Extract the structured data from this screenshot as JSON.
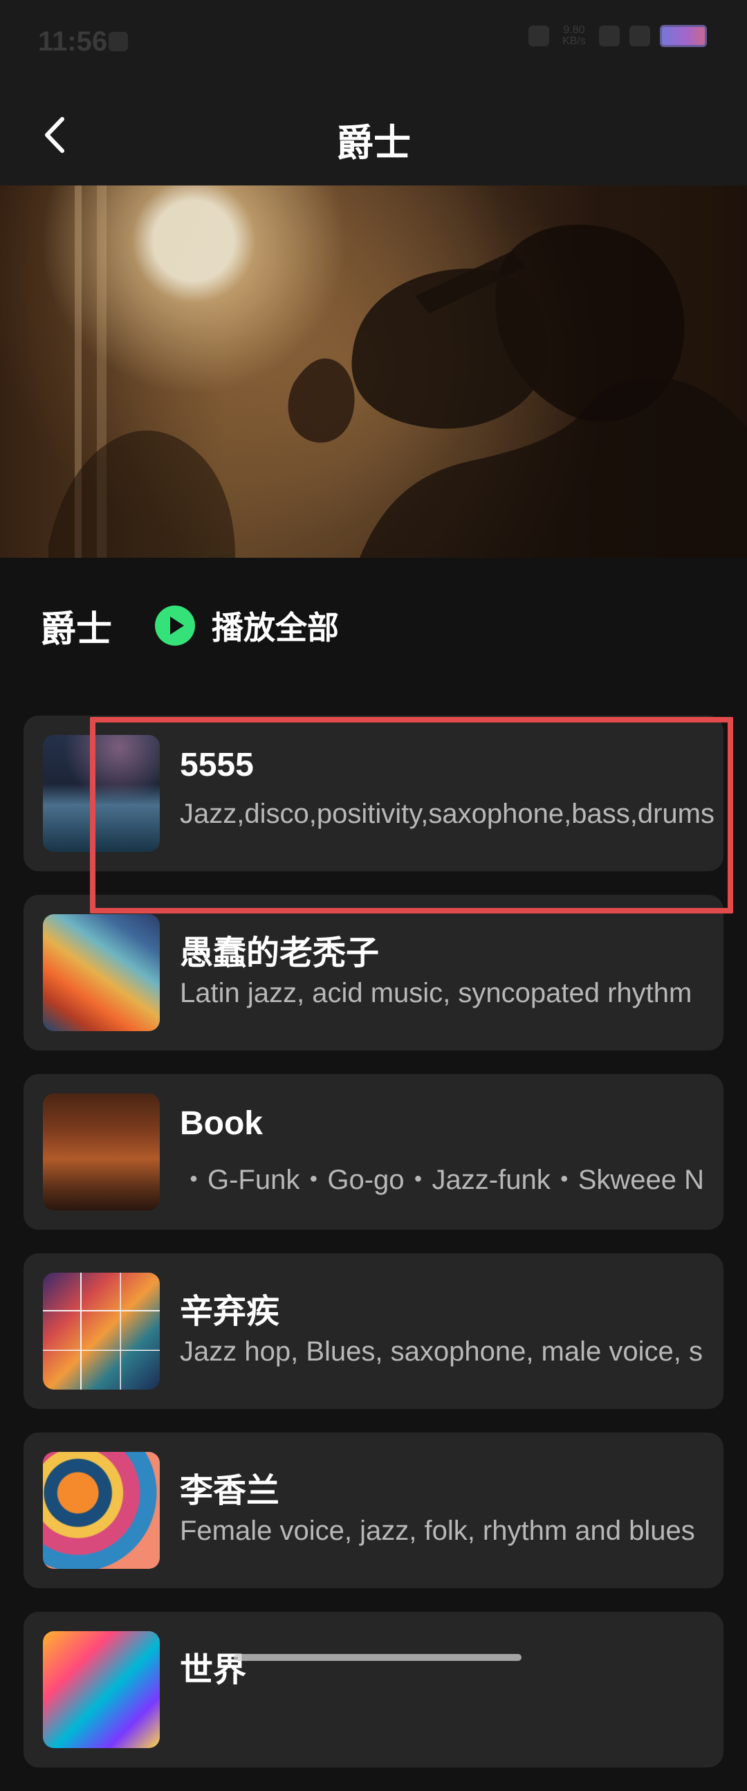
{
  "status_bar": {
    "time": "11:56",
    "net_speed": "9.80\nKB/s"
  },
  "header": {
    "title": "爵士",
    "back_icon": "chevron-left-icon"
  },
  "hero": {
    "image_desc": "saxophone-player-hero-image"
  },
  "section": {
    "title": "爵士",
    "play_all_label": "播放全部",
    "play_icon": "play-circle-icon",
    "accent_color": "#35e27a"
  },
  "songs": [
    {
      "name": "5555",
      "desc": " Jazz,disco,positivity,saxophone,bass,drums"
    },
    {
      "name": "愚蠢的老秃子",
      "desc": "Latin jazz, acid music, syncopated rhythm"
    },
    {
      "name": "Book",
      "desc": "・G-Funk・Go-go・Jazz-funk・Skweee N"
    },
    {
      "name": "辛弃疾",
      "desc": "Jazz hop, Blues, saxophone, male voice, s"
    },
    {
      "name": "李香兰",
      "desc": " Female voice, jazz, folk, rhythm and blues"
    },
    {
      "name": "世界",
      "desc": ""
    }
  ],
  "highlight": {
    "color": "#e24b4b"
  }
}
